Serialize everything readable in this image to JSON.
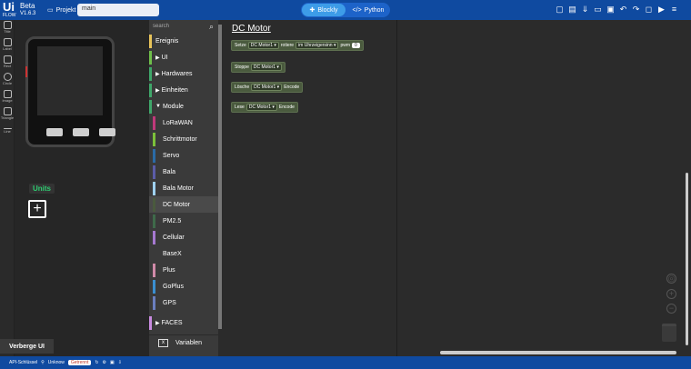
{
  "app": {
    "logo": "Ui",
    "logo_sub": "FLOW",
    "edition": "Beta",
    "version": "V1.6.3"
  },
  "header": {
    "projekt_label": "Projekt",
    "project_name": "main",
    "mode_blockly": "Blockly",
    "mode_python": "Python"
  },
  "sidebar": {
    "items": [
      {
        "label": "Title",
        "icon": "title-icon"
      },
      {
        "label": "Label",
        "icon": "label-icon"
      },
      {
        "label": "Rect",
        "icon": "rect-icon"
      },
      {
        "label": "Circle",
        "icon": "circle-icon"
      },
      {
        "label": "Image",
        "icon": "image-icon"
      },
      {
        "label": "Triangle",
        "icon": "triangle-icon"
      },
      {
        "label": "Line",
        "icon": "line-icon"
      }
    ]
  },
  "device_panel": {
    "units_label": "Units",
    "hide_ui": "Verberge UI"
  },
  "toolbox": {
    "search_placeholder": "search",
    "categories": [
      {
        "label": "Ereignis",
        "color": "#e8c45a"
      },
      {
        "label": "UI",
        "color": "#6fbf4a"
      },
      {
        "label": "Hardwares",
        "color": "#3fa76a"
      },
      {
        "label": "Einheiten",
        "color": "#3fa76a"
      },
      {
        "label": "Module",
        "color": "#3fa76a"
      },
      {
        "label": "LoRaWAN",
        "color": "#c0397a"
      },
      {
        "label": "Schrittmotor",
        "color": "#7cc03a"
      },
      {
        "label": "Servo",
        "color": "#2a6aa6"
      },
      {
        "label": "Bala",
        "color": "#5b5ca8"
      },
      {
        "label": "Bala Motor",
        "color": "#9fd1f0"
      },
      {
        "label": "DC Motor",
        "color": "#4a5a3e"
      },
      {
        "label": "PM2.5",
        "color": "#3f6a4a"
      },
      {
        "label": "Cellular",
        "color": "#a679d1"
      },
      {
        "label": "BaseX",
        "color": "#3a3a3a"
      },
      {
        "label": "Plus",
        "color": "#d08aa8"
      },
      {
        "label": "GoPlus",
        "color": "#3a8fd1"
      },
      {
        "label": "GPS",
        "color": "#6a7fbf"
      },
      {
        "label": "FACES",
        "color": "#c98be0"
      }
    ],
    "variablen": "Variablen"
  },
  "workspace": {
    "title": "DC Motor",
    "blocks": [
      {
        "parts": [
          "Setze",
          "DC Motor1 ▾",
          "rotiere",
          "im Uhrzeigersinn ▾",
          "pwm",
          "0"
        ]
      },
      {
        "parts": [
          "Stoppe",
          "DC Motor1 ▾"
        ]
      },
      {
        "parts": [
          "Lösche",
          "DC Motor1 ▾",
          "Encode"
        ]
      },
      {
        "parts": [
          "Lese",
          "DC Motor1 ▾",
          "Encode"
        ]
      }
    ]
  },
  "statusbar": {
    "api": "API-Schlüssel",
    "status": "Unknow",
    "warning": "Getrennt"
  }
}
